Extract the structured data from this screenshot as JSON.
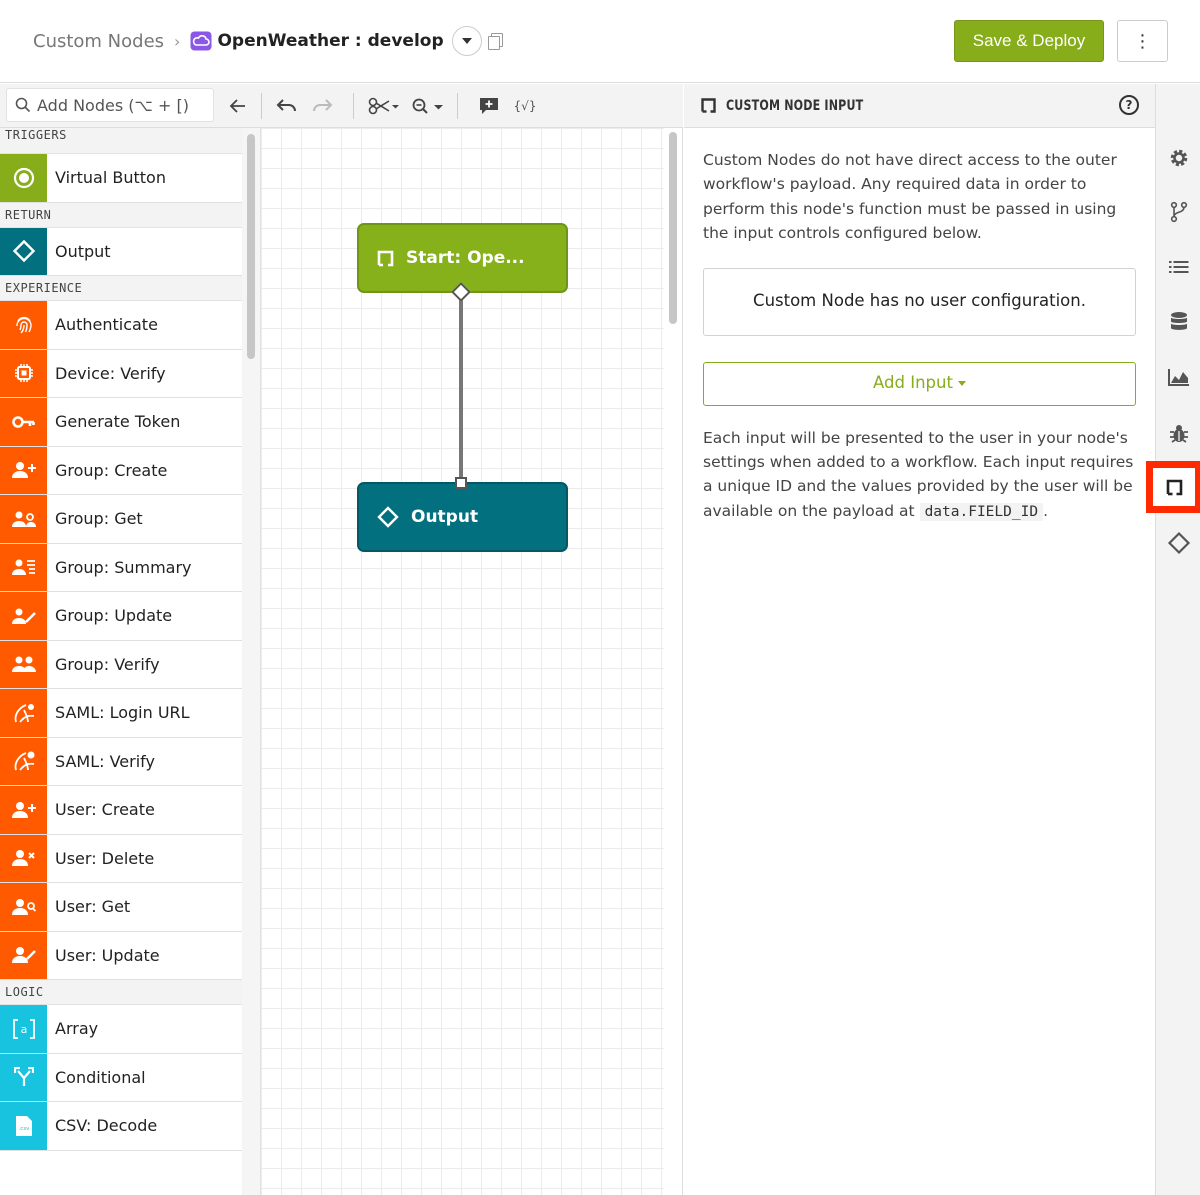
{
  "header": {
    "breadcrumb_root": "Custom Nodes",
    "breadcrumb_separator": "›",
    "title": "OpenWeather : develop",
    "save_label": "Save & Deploy",
    "more_label": "⋮"
  },
  "toolbar": {
    "search_placeholder": "Add Nodes (⌥ + [)",
    "icons": [
      "back-arrow-icon",
      "undo-icon",
      "redo-icon",
      "scissors-icon",
      "zoom-icon",
      "add-comment-icon",
      "template-icon"
    ]
  },
  "palette": {
    "categories": [
      {
        "name": "TRIGGERS",
        "color": "#87ad1a",
        "items": [
          {
            "label": "Virtual Button",
            "icon": "virtual-button-icon"
          }
        ]
      },
      {
        "name": "RETURN",
        "color": "#03707f",
        "items": [
          {
            "label": "Output",
            "icon": "output-icon"
          }
        ]
      },
      {
        "name": "EXPERIENCE",
        "color": "#ff5a00",
        "items": [
          {
            "label": "Authenticate",
            "icon": "fingerprint-icon"
          },
          {
            "label": "Device: Verify",
            "icon": "chip-icon"
          },
          {
            "label": "Generate Token",
            "icon": "key-icon"
          },
          {
            "label": "Group: Create",
            "icon": "group-add-icon"
          },
          {
            "label": "Group: Get",
            "icon": "group-search-icon"
          },
          {
            "label": "Group: Summary",
            "icon": "group-list-icon"
          },
          {
            "label": "Group: Update",
            "icon": "group-edit-icon"
          },
          {
            "label": "Group: Verify",
            "icon": "group-icon"
          },
          {
            "label": "SAML: Login URL",
            "icon": "saml-icon"
          },
          {
            "label": "SAML: Verify",
            "icon": "saml-verify-icon"
          },
          {
            "label": "User: Create",
            "icon": "user-add-icon"
          },
          {
            "label": "User: Delete",
            "icon": "user-delete-icon"
          },
          {
            "label": "User: Get",
            "icon": "user-search-icon"
          },
          {
            "label": "User: Update",
            "icon": "user-edit-icon"
          }
        ]
      },
      {
        "name": "LOGIC",
        "color": "#18c3e0",
        "items": [
          {
            "label": "Array",
            "icon": "array-icon"
          },
          {
            "label": "Conditional",
            "icon": "conditional-icon"
          },
          {
            "label": "CSV: Decode",
            "icon": "csv-icon"
          }
        ]
      }
    ]
  },
  "canvas": {
    "start_node": "Start: Ope...",
    "output_node": "Output"
  },
  "panel": {
    "title": "CUSTOM NODE INPUT",
    "help": "?",
    "intro": "Custom Nodes do not have direct access to the outer workflow's payload. Any required data in order to perform this node's function must be passed in using the input controls configured below.",
    "no_config": "Custom Node has no user configuration.",
    "add_input": "Add Input",
    "desc_before": "Each input will be presented to the user in your node's settings when added to a workflow. Each input requires a unique ID and the values provided by the user will be available on the payload at",
    "desc_code": "data.FIELD_ID",
    "desc_after": "."
  },
  "rail": {
    "icons": [
      "gear-icon",
      "branch-icon",
      "list-icon",
      "database-icon",
      "chart-icon",
      "bug-icon",
      "custom-node-input-icon",
      "output-icon"
    ],
    "active": "custom-node-input-icon"
  }
}
